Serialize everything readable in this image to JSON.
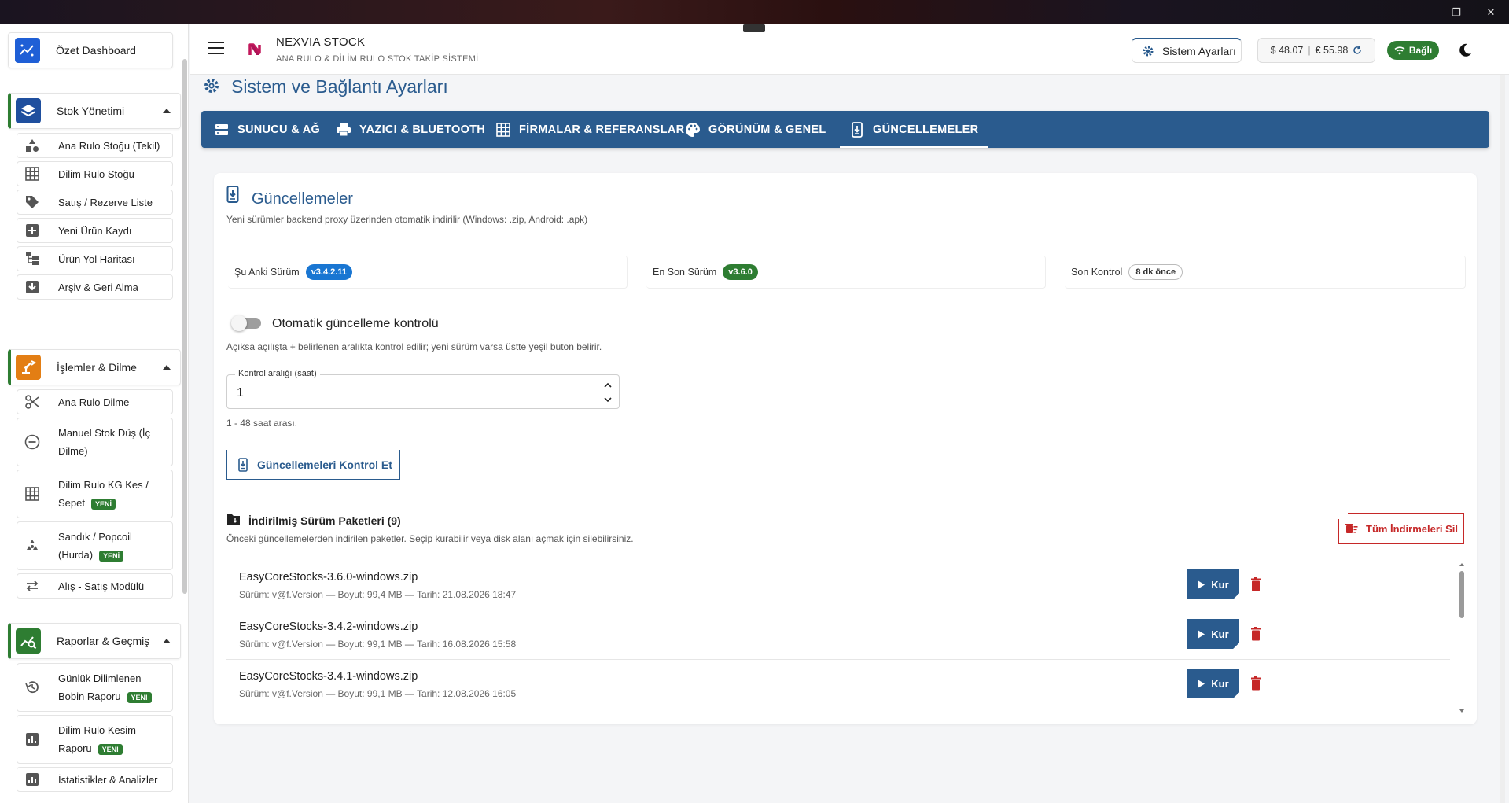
{
  "window": {
    "minimize": "—",
    "maximize": "❐",
    "close": "✕"
  },
  "sidebar": {
    "top": {
      "label": "Özet Dashboard"
    },
    "sections": [
      {
        "label": "Stok Yönetimi",
        "items": [
          {
            "label": "Ana Rulo Stoğu (Tekil)"
          },
          {
            "label": "Dilim Rulo Stoğu"
          },
          {
            "label": "Satış / Rezerve Liste"
          },
          {
            "label": "Yeni Ürün Kaydı"
          },
          {
            "label": "Ürün Yol Haritası"
          },
          {
            "label": "Arşiv & Geri Alma"
          }
        ]
      },
      {
        "label": "İşlemler & Dilme",
        "items": [
          {
            "label": "Ana Rulo Dilme"
          },
          {
            "label1": "Manuel Stok Düş (İç",
            "label2": "Dilme)"
          },
          {
            "label1": "Dilim Rulo KG Kes /",
            "label2": "Sepet",
            "badge": "YENİ"
          },
          {
            "label1": "Sandık / Popcoil",
            "label2": "(Hurda)",
            "badge": "YENİ"
          },
          {
            "label": "Alış - Satış Modülü"
          }
        ]
      },
      {
        "label": "Raporlar & Geçmiş",
        "items": [
          {
            "label1": "Günlük Dilimlenen",
            "label2": "Bobin Raporu",
            "badge": "YENİ"
          },
          {
            "label1": "Dilim Rulo Kesim",
            "label2": "Raporu",
            "badge": "YENİ"
          },
          {
            "label": "İstatistikler & Analizler"
          }
        ]
      }
    ]
  },
  "header": {
    "brand_title": "NEXVIA STOCK",
    "brand_sub": "ANA RULO & DİLİM RULO STOK TAKİP SİSTEMİ",
    "settings_label": "Sistem Ayarları",
    "usd": "$ 48.07",
    "sep": "|",
    "eur": "€ 55.98",
    "connection": "Bağlı"
  },
  "page": {
    "title": "Sistem ve Bağlantı Ayarları",
    "tabs": [
      {
        "label": "SUNUCU & AĞ"
      },
      {
        "label": "YAZICI & BLUETOOTH"
      },
      {
        "label": "FİRMALAR & REFERANSLAR"
      },
      {
        "label": "GÖRÜNÜM & GENEL"
      },
      {
        "label": "GÜNCELLEMELER"
      }
    ]
  },
  "updates": {
    "title": "Güncellemeler",
    "desc": "Yeni sürümler backend proxy üzerinden otomatik indirilir (Windows: .zip, Android: .apk)",
    "current_label": "Şu Anki Sürüm",
    "current_version": "v3.4.2.11",
    "latest_label": "En Son Sürüm",
    "latest_version": "v3.6.0",
    "last_check_label": "Son Kontrol",
    "last_check_value": "8 dk önce",
    "auto_check_label": "Otomatik güncelleme kontrolü",
    "auto_check_on": false,
    "auto_check_desc": "Açıksa açılışta + belirlenen aralıkta kontrol edilir; yeni sürüm varsa üstte yeşil buton belirir.",
    "interval_label": "Kontrol aralığı (saat)",
    "interval_value": "1",
    "interval_hint": "1 - 48 saat arası.",
    "check_button": "Güncellemeleri Kontrol Et",
    "packages_title": "İndirilmiş Sürüm Paketleri (9)",
    "packages_desc": "Önceki güncellemelerden indirilen paketler. Seçip kurabilir veya disk alanı açmak için silebilirsiniz.",
    "delete_all": "Tüm İndirmeleri Sil",
    "install_label": "Kur",
    "packages": [
      {
        "name": "EasyCoreStocks-3.6.0-windows.zip",
        "meta": "Sürüm: v@f.Version — Boyut: 99,4 MB — Tarih: 21.08.2026 18:47"
      },
      {
        "name": "EasyCoreStocks-3.4.2-windows.zip",
        "meta": "Sürüm: v@f.Version — Boyut: 99,1 MB — Tarih: 16.08.2026 15:58"
      },
      {
        "name": "EasyCoreStocks-3.4.1-windows.zip",
        "meta": "Sürüm: v@f.Version — Boyut: 99,1 MB — Tarih: 12.08.2026 16:05"
      }
    ]
  },
  "colors": {
    "primary": "#2a5b8e",
    "success": "#2e7d32",
    "danger": "#c62828",
    "current_chip": "#1976d2"
  }
}
